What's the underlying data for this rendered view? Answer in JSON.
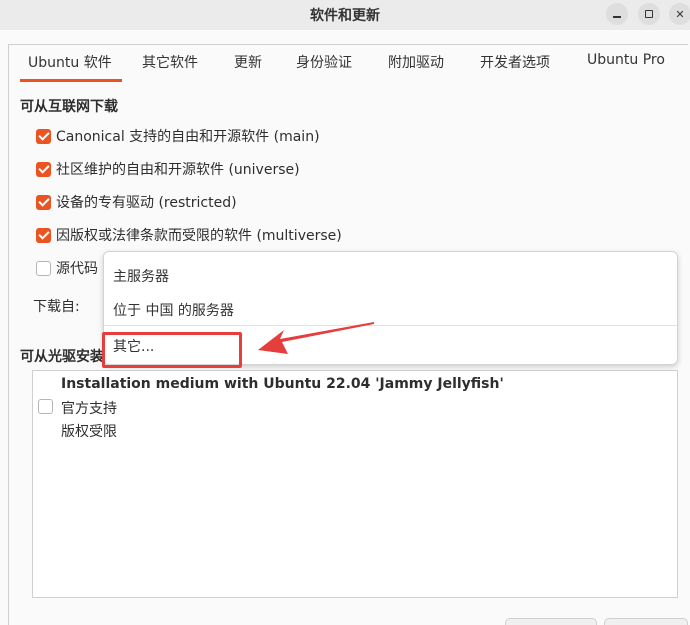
{
  "window": {
    "title": "软件和更新"
  },
  "tabs": [
    {
      "label": "Ubuntu 软件",
      "active": true
    },
    {
      "label": "其它软件",
      "active": false
    },
    {
      "label": "更新",
      "active": false
    },
    {
      "label": "身份验证",
      "active": false
    },
    {
      "label": "附加驱动",
      "active": false
    },
    {
      "label": "开发者选项",
      "active": false
    },
    {
      "label": "Ubuntu Pro",
      "active": false
    }
  ],
  "internet": {
    "section_title": "可从互联网下载",
    "options": [
      {
        "label": "Canonical 支持的自由和开源软件 (main)",
        "checked": true
      },
      {
        "label": "社区维护的自由和开源软件 (universe)",
        "checked": true
      },
      {
        "label": "设备的专有驱动 (restricted)",
        "checked": true
      },
      {
        "label": "因版权或法律条款而受限的软件 (multiverse)",
        "checked": true
      },
      {
        "label": "源代码",
        "checked": false
      }
    ],
    "download_from_label": "下载自:"
  },
  "server_menu": {
    "items": [
      "主服务器",
      "位于 中国 的服务器",
      "其它..."
    ]
  },
  "cdrom": {
    "section_title": "可从光驱安装",
    "media": {
      "name": "Installation medium with Ubuntu 22.04 'Jammy Jellyfish'",
      "line1": "官方支持",
      "line2": "版权受限",
      "checked": false
    }
  },
  "colors": {
    "accent": "#e95420",
    "annotation": "#e63d3d"
  }
}
